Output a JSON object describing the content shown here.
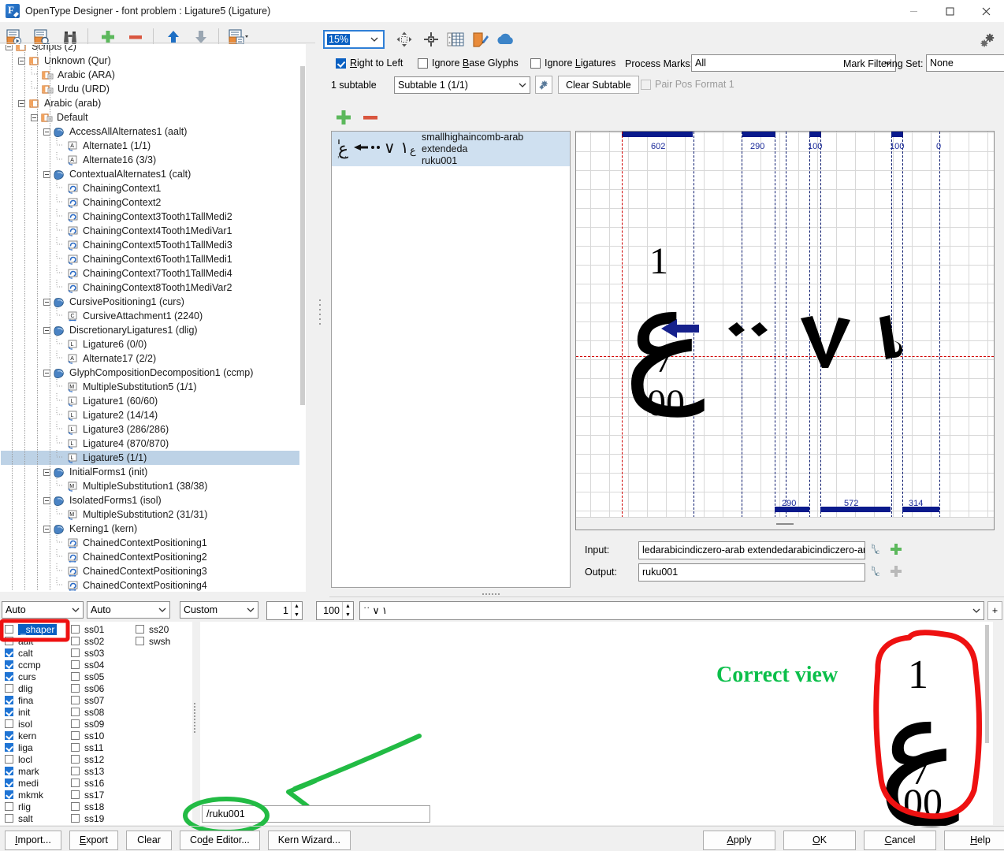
{
  "window": {
    "title": "OpenType Designer - font problem : Ligature5 (Ligature)",
    "app_icon": "font-designer-icon",
    "minimize": "—",
    "maximize": "□",
    "close": "✕"
  },
  "toolbar": {
    "buttons": [
      {
        "name": "new-feature-icon",
        "label": ""
      },
      {
        "name": "find-feature-icon",
        "label": ""
      },
      {
        "name": "binoculars-icon",
        "label": ""
      },
      {
        "name": "add-icon",
        "label": "+"
      },
      {
        "name": "remove-icon",
        "label": "—"
      },
      {
        "name": "move-up-icon",
        "label": "↑"
      },
      {
        "name": "move-down-icon",
        "label": "↓"
      },
      {
        "name": "table-options-icon",
        "label": ""
      }
    ],
    "settings_icon": "gears-icon"
  },
  "tree": {
    "items": [
      {
        "depth": 1,
        "label": "Scripts (2)",
        "icon": "folder-icon",
        "expander": "minus",
        "clipped": true
      },
      {
        "depth": 2,
        "label": "Unknown (Qur)",
        "icon": "script-icon",
        "expander": "minus"
      },
      {
        "depth": 3,
        "label": "Arabic (ARA)",
        "icon": "language-icon",
        "expander": "none"
      },
      {
        "depth": 3,
        "label": "Urdu (URD)",
        "icon": "language-icon",
        "expander": "none"
      },
      {
        "depth": 2,
        "label": "Arabic (arab)",
        "icon": "script-icon",
        "expander": "minus"
      },
      {
        "depth": 3,
        "label": "Default",
        "icon": "language-icon",
        "expander": "minus"
      },
      {
        "depth": 4,
        "label": "AccessAllAlternates1 (aalt)",
        "icon": "feature-icon",
        "expander": "minus"
      },
      {
        "depth": 5,
        "label": "Alternate1 (1/1)",
        "icon": "alternate-icon",
        "expander": "none"
      },
      {
        "depth": 5,
        "label": "Alternate16 (3/3)",
        "icon": "alternate-icon",
        "expander": "none"
      },
      {
        "depth": 4,
        "label": "ContextualAlternates1 (calt)",
        "icon": "feature-icon",
        "expander": "minus"
      },
      {
        "depth": 5,
        "label": "ChainingContext1",
        "icon": "chaining-icon",
        "expander": "none"
      },
      {
        "depth": 5,
        "label": "ChainingContext2",
        "icon": "chaining-icon",
        "expander": "none"
      },
      {
        "depth": 5,
        "label": "ChainingContext3Tooth1TallMedi2",
        "icon": "chaining-icon",
        "expander": "none"
      },
      {
        "depth": 5,
        "label": "ChainingContext4Tooth1MediVar1",
        "icon": "chaining-icon",
        "expander": "none"
      },
      {
        "depth": 5,
        "label": "ChainingContext5Tooth1TallMedi3",
        "icon": "chaining-icon",
        "expander": "none"
      },
      {
        "depth": 5,
        "label": "ChainingContext6Tooth1TallMedi1",
        "icon": "chaining-icon",
        "expander": "none"
      },
      {
        "depth": 5,
        "label": "ChainingContext7Tooth1TallMedi4",
        "icon": "chaining-icon",
        "expander": "none"
      },
      {
        "depth": 5,
        "label": "ChainingContext8Tooth1MediVar2",
        "icon": "chaining-icon",
        "expander": "none"
      },
      {
        "depth": 4,
        "label": "CursivePositioning1 (curs)",
        "icon": "feature-icon",
        "expander": "minus"
      },
      {
        "depth": 5,
        "label": "CursiveAttachment1 (2240)",
        "icon": "cursive-icon",
        "expander": "none"
      },
      {
        "depth": 4,
        "label": "DiscretionaryLigatures1 (dlig)",
        "icon": "feature-icon",
        "expander": "minus"
      },
      {
        "depth": 5,
        "label": "Ligature6 (0/0)",
        "icon": "ligature-icon",
        "expander": "none"
      },
      {
        "depth": 5,
        "label": "Alternate17 (2/2)",
        "icon": "alternate-icon",
        "expander": "none"
      },
      {
        "depth": 4,
        "label": "GlyphCompositionDecomposition1 (ccmp)",
        "icon": "feature-icon",
        "expander": "minus"
      },
      {
        "depth": 5,
        "label": "MultipleSubstitution5 (1/1)",
        "icon": "multiple-sub-icon",
        "expander": "none"
      },
      {
        "depth": 5,
        "label": "Ligature1 (60/60)",
        "icon": "ligature-icon",
        "expander": "none"
      },
      {
        "depth": 5,
        "label": "Ligature2 (14/14)",
        "icon": "ligature-icon",
        "expander": "none"
      },
      {
        "depth": 5,
        "label": "Ligature3 (286/286)",
        "icon": "ligature-icon",
        "expander": "none"
      },
      {
        "depth": 5,
        "label": "Ligature4 (870/870)",
        "icon": "ligature-icon",
        "expander": "none"
      },
      {
        "depth": 5,
        "label": "Ligature5 (1/1)",
        "icon": "ligature-icon",
        "expander": "none",
        "selected": true
      },
      {
        "depth": 4,
        "label": "InitialForms1 (init)",
        "icon": "feature-icon",
        "expander": "minus"
      },
      {
        "depth": 5,
        "label": "MultipleSubstitution1 (38/38)",
        "icon": "multiple-sub-icon",
        "expander": "none"
      },
      {
        "depth": 4,
        "label": "IsolatedForms1 (isol)",
        "icon": "feature-icon",
        "expander": "minus"
      },
      {
        "depth": 5,
        "label": "MultipleSubstitution2 (31/31)",
        "icon": "multiple-sub-icon",
        "expander": "none"
      },
      {
        "depth": 4,
        "label": "Kerning1 (kern)",
        "icon": "feature-icon",
        "expander": "minus"
      },
      {
        "depth": 5,
        "label": "ChainedContextPositioning1",
        "icon": "chained-pos-icon",
        "expander": "none"
      },
      {
        "depth": 5,
        "label": "ChainedContextPositioning2",
        "icon": "chained-pos-icon",
        "expander": "none"
      },
      {
        "depth": 5,
        "label": "ChainedContextPositioning3",
        "icon": "chained-pos-icon",
        "expander": "none"
      },
      {
        "depth": 5,
        "label": "ChainedContextPositioning4",
        "icon": "chained-pos-icon",
        "expander": "none"
      }
    ]
  },
  "options": {
    "zoom_value": "15%",
    "right_to_left": {
      "label": "Right to Left",
      "accel": "R",
      "checked": true
    },
    "ignore_base_glyphs": {
      "label": "Ignore Base Glyphs",
      "accel": "B",
      "checked": false
    },
    "ignore_ligatures": {
      "label": "Ignore Ligatures",
      "accel": "L",
      "checked": false
    },
    "process_marks_label": "Process Marks:",
    "process_marks_value": "All",
    "mark_filtering_label": "Mark Filtering Set:",
    "mark_filtering_value": "None",
    "subtable_count": "1 subtable",
    "subtable_value": "Subtable 1 (1/1)",
    "subtable_settings_icon": "gear-icon",
    "clear_subtable_label": "Clear Subtable",
    "pair_pos_format": {
      "label": "Pair Pos Format 1",
      "checked": false,
      "disabled": true
    }
  },
  "list": {
    "add_icon": "add-lookup-icon",
    "remove_icon": "remove-lookup-icon",
    "items": [
      {
        "glyph_preview": "ع ← ˙˙ ∨ ١ع",
        "input_text": "smallhighaincomb-arab extendeda",
        "output_text": "ruku001",
        "selected": true
      }
    ]
  },
  "canvas": {
    "top_widths": [
      "602",
      "290",
      "100",
      "100",
      "0"
    ],
    "bottom_widths": [
      "290",
      "572",
      "314"
    ],
    "arrow_color": "#16218c",
    "baseline_color": "#d00000",
    "glyph_row": [
      "ع",
      "←",
      "˙˙",
      "∨",
      "١"
    ]
  },
  "io": {
    "input_label": "Input:",
    "input_value": "ledarabicindiczero-arab extendedarabicindiczero-arab",
    "output_label": "Output:",
    "output_value": "ruku001",
    "input_picker_icon": "glyph-picker-icon",
    "input_add_icon": "add-green-icon",
    "output_picker_icon": "glyph-picker-icon",
    "output_add_icon": "add-grey-icon"
  },
  "preview_toolbar": {
    "combo1": "Auto",
    "combo2": "Auto",
    "combo3": "Custom",
    "spin1": "1",
    "spin2": "100",
    "sample_text": "˙˙ ∨ ١",
    "add_icon": "+"
  },
  "features": {
    "col1": [
      {
        "tag": "_shaper",
        "checked": false,
        "selected": true,
        "highlighted": true
      },
      {
        "tag": "aalt",
        "checked": false
      },
      {
        "tag": "calt",
        "checked": true
      },
      {
        "tag": "ccmp",
        "checked": true
      },
      {
        "tag": "curs",
        "checked": true
      },
      {
        "tag": "dlig",
        "checked": false
      },
      {
        "tag": "fina",
        "checked": true
      },
      {
        "tag": "init",
        "checked": true
      },
      {
        "tag": "isol",
        "checked": false
      },
      {
        "tag": "kern",
        "checked": true
      },
      {
        "tag": "liga",
        "checked": true
      },
      {
        "tag": "locl",
        "checked": false
      },
      {
        "tag": "mark",
        "checked": true
      },
      {
        "tag": "medi",
        "checked": true
      },
      {
        "tag": "mkmk",
        "checked": true
      },
      {
        "tag": "rlig",
        "checked": false
      },
      {
        "tag": "salt",
        "checked": false
      }
    ],
    "col2": [
      {
        "tag": "ss01",
        "checked": false
      },
      {
        "tag": "ss02",
        "checked": false
      },
      {
        "tag": "ss03",
        "checked": false
      },
      {
        "tag": "ss04",
        "checked": false
      },
      {
        "tag": "ss05",
        "checked": false
      },
      {
        "tag": "ss06",
        "checked": false
      },
      {
        "tag": "ss07",
        "checked": false
      },
      {
        "tag": "ss08",
        "checked": false
      },
      {
        "tag": "ss09",
        "checked": false
      },
      {
        "tag": "ss10",
        "checked": false
      },
      {
        "tag": "ss11",
        "checked": false
      },
      {
        "tag": "ss12",
        "checked": false
      },
      {
        "tag": "ss13",
        "checked": false
      },
      {
        "tag": "ss16",
        "checked": false
      },
      {
        "tag": "ss17",
        "checked": false
      },
      {
        "tag": "ss18",
        "checked": false
      },
      {
        "tag": "ss19",
        "checked": false
      }
    ],
    "col3": [
      {
        "tag": "ss20",
        "checked": false
      },
      {
        "tag": "swsh",
        "checked": false
      }
    ]
  },
  "annotations": {
    "correct_view_label": "Correct view",
    "correct_view_color": "#0bbf4a",
    "highlight_color": "#ee1111",
    "arrow_color": "#22bb44"
  },
  "url_field": {
    "value": "/ruku001"
  },
  "bottom_buttons_left": [
    {
      "label": "Import...",
      "accel": "I"
    },
    {
      "label": "Export",
      "accel": "E"
    },
    {
      "label": "Clear",
      "accel": ""
    },
    {
      "label": "Code Editor...",
      "accel": "d"
    },
    {
      "label": "Kern Wizard...",
      "accel": ""
    }
  ],
  "bottom_buttons_right": [
    {
      "label": "Apply",
      "accel": "A"
    },
    {
      "label": "OK",
      "accel": "O"
    },
    {
      "label": "Cancel",
      "accel": "C"
    },
    {
      "label": "Help",
      "accel": "H"
    }
  ]
}
